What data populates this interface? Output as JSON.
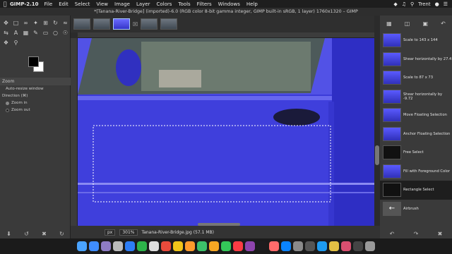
{
  "menubar": {
    "apple": "",
    "app": "GIMP-2.10",
    "menus": [
      "File",
      "Edit",
      "Select",
      "View",
      "Image",
      "Layer",
      "Colors",
      "Tools",
      "Filters",
      "Windows",
      "Help"
    ],
    "user": "Trent",
    "right_icons": [
      "dropbox-icon",
      "volume-icon",
      "airplay-icon",
      "search-icon",
      "siri-icon",
      "notifications-icon"
    ]
  },
  "window": {
    "title": "*[Tanana-River-Bridge] (imported)-6.0 (RGB color 8-bit gamma integer, GIMP built-in sRGB, 1 layer) 1760x1320 – GIMP"
  },
  "tool_options": {
    "title": "Zoom",
    "auto_resize": "Auto-resize window",
    "direction_label": "Direction  (⌘)",
    "zoom_in": "Zoom in",
    "zoom_out": "Zoom out"
  },
  "statusbar": {
    "unit": "px",
    "zoom": "301%",
    "filename": "Tanana-River-Bridge.jpg (57.1 MB)"
  },
  "history": {
    "items": [
      "Scale to 143 x 144",
      "Shear horizontally by 27.4",
      "Scale to 87 x 73",
      "Shear horizontally by -9.72",
      "Move Floating Selection",
      "Anchor Floating Selection",
      "Free Select",
      "Fill with Foreground Color",
      "Rectangle Select",
      "Airbrush"
    ]
  },
  "colors": {
    "accent": "#3a3ad8",
    "fg": "#000000",
    "bg": "#ffffff"
  }
}
